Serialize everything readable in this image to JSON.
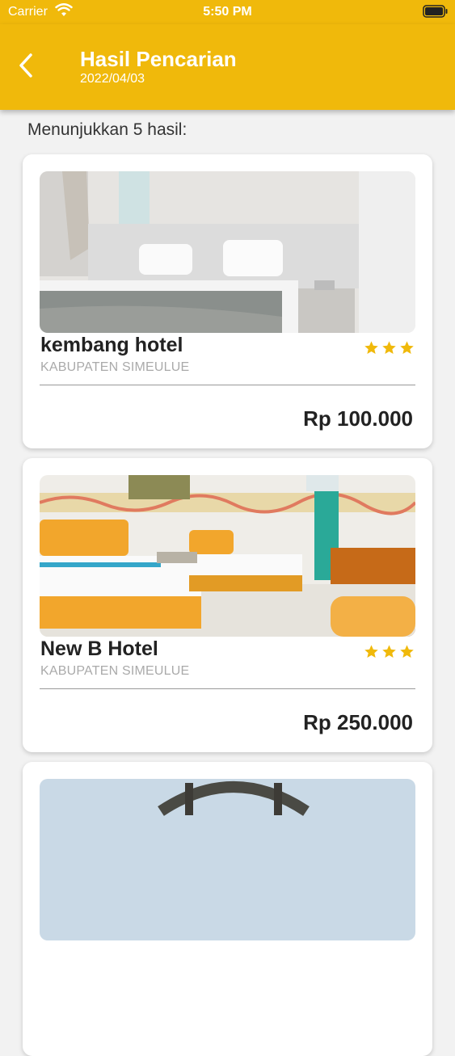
{
  "status_bar": {
    "carrier": "Carrier",
    "time": "5:50 PM"
  },
  "header": {
    "title": "Hasil Pencarian",
    "date": "2022/04/03"
  },
  "results": {
    "summary": "Menunjukkan 5 hasil:"
  },
  "hotels": [
    {
      "name": "kembang hotel",
      "location": "KABUPATEN SIMEULUE",
      "price": "Rp 100.000",
      "stars": 3
    },
    {
      "name": "New B Hotel",
      "location": "KABUPATEN SIMEULUE",
      "price": "Rp 250.000",
      "stars": 3
    }
  ],
  "colors": {
    "accent": "#f0b90b",
    "star": "#f0b90b"
  }
}
